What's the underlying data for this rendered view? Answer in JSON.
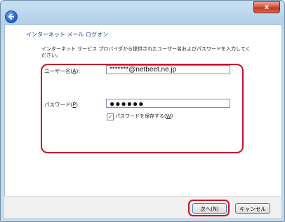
{
  "window": {
    "close_label": "x"
  },
  "heading": "インターネット メール ログオン",
  "description": "インターネット サービス プロバイダから提供されたユーザー名およびパスワードを入力してください。",
  "username": {
    "label_prefix": "ユーザー名(",
    "label_key": "A",
    "label_suffix": "):",
    "value": "*******@netbeet.ne.jp"
  },
  "password": {
    "label_prefix": "パスワード(",
    "label_key": "P",
    "label_suffix": "):",
    "value": "●●●●●●"
  },
  "remember": {
    "checked_mark": "✓",
    "label_prefix": "パスワードを保存する(",
    "label_key": "W",
    "label_suffix": ")"
  },
  "buttons": {
    "next": "次へ(N)",
    "cancel": "キャンセル"
  },
  "colors": {
    "highlight": "#c8102e",
    "heading": "#1e3f8a"
  }
}
